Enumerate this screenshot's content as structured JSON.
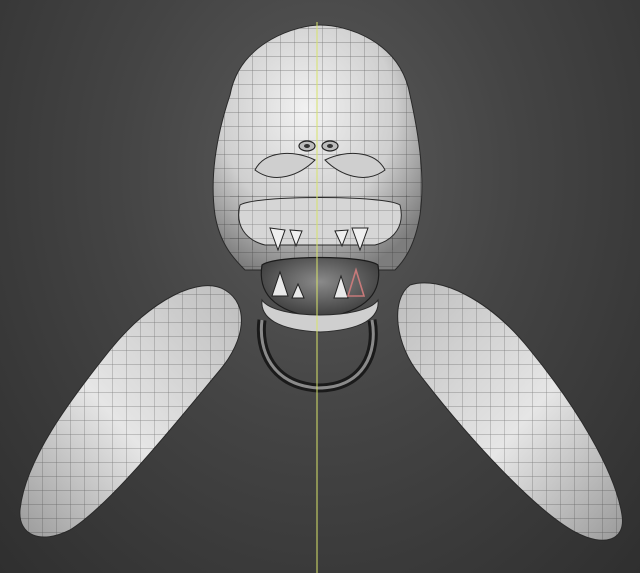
{
  "viewport": {
    "background_color": "#3f3f3f",
    "mesh_color": "#d8d8d8",
    "wire_color": "#1e1e1e",
    "center_axis_color": "#d7e36a",
    "highlight_wire_color": "#c77a7a"
  }
}
